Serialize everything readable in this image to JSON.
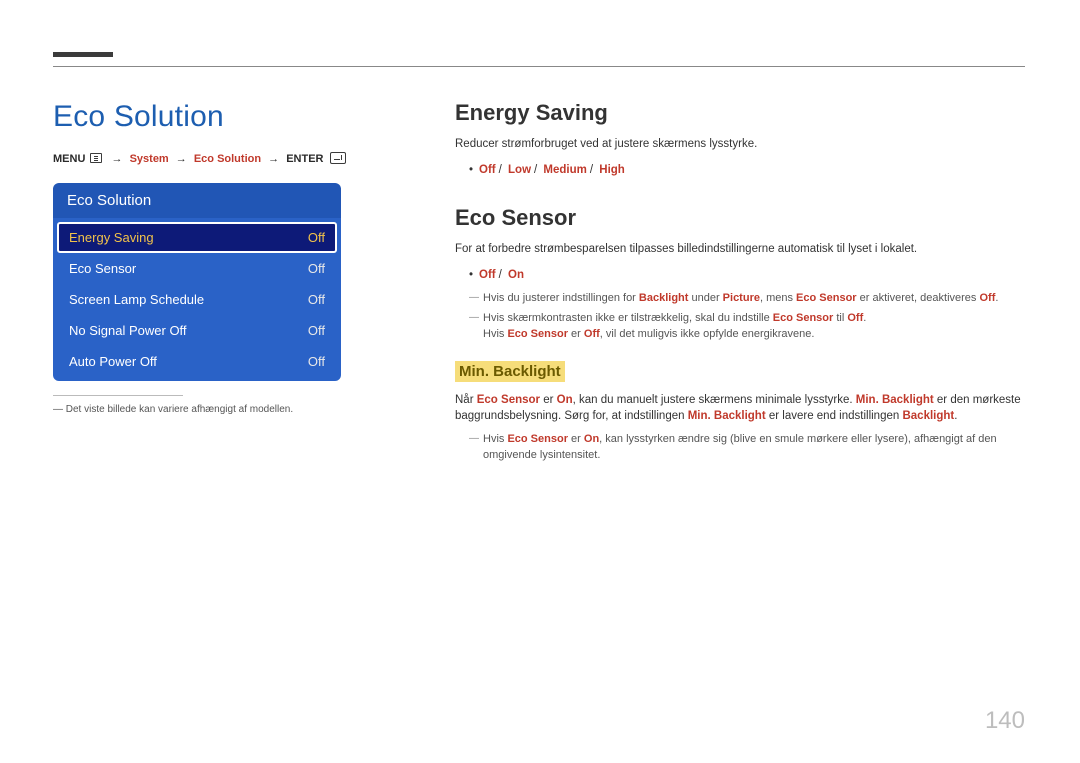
{
  "page_number": "140",
  "main_title": "Eco Solution",
  "breadcrumb": {
    "menu": "MENU",
    "system": "System",
    "eco": "Eco Solution",
    "enter": "ENTER"
  },
  "osd": {
    "title": "Eco Solution",
    "rows": [
      {
        "label": "Energy Saving",
        "value": "Off",
        "selected": true
      },
      {
        "label": "Eco Sensor",
        "value": "Off",
        "selected": false
      },
      {
        "label": "Screen Lamp Schedule",
        "value": "Off",
        "selected": false
      },
      {
        "label": "No Signal Power Off",
        "value": "Off",
        "selected": false
      },
      {
        "label": "Auto Power Off",
        "value": "Off",
        "selected": false
      }
    ]
  },
  "footnote": "― Det viste billede kan variere afhængigt af modellen.",
  "energy_saving": {
    "title": "Energy Saving",
    "desc": "Reducer strømforbruget ved at justere skærmens lysstyrke.",
    "opts": {
      "off": "Off",
      "low": "Low",
      "medium": "Medium",
      "high": "High"
    }
  },
  "eco_sensor": {
    "title": "Eco Sensor",
    "desc": "For at forbedre strømbesparelsen tilpasses billedindstillingerne automatisk til lyset i lokalet.",
    "opts": {
      "off": "Off",
      "on": "On"
    },
    "note1": {
      "pre": "Hvis du justerer indstillingen for ",
      "backlight": "Backlight",
      "mid1": " under ",
      "picture": "Picture",
      "mid2": ", mens ",
      "ecosensor": "Eco Sensor",
      "mid3": " er aktiveret, deaktiveres ",
      "off": "Off",
      "end": "."
    },
    "note2": {
      "pre": "Hvis skærmkontrasten ikke er tilstrækkelig, skal du indstille ",
      "ecosensor": "Eco Sensor",
      "mid": " til ",
      "off": "Off",
      "end": "."
    },
    "note3": {
      "pre": "Hvis ",
      "ecosensor": "Eco Sensor",
      "mid": " er ",
      "off": "Off",
      "end": ", vil det muligvis ikke opfylde energikravene."
    }
  },
  "min_backlight": {
    "title": "Min. Backlight",
    "p1": {
      "pre": "Når ",
      "ecosensor": "Eco Sensor",
      "mid1": " er ",
      "on": "On",
      "mid2": ", kan du manuelt justere skærmens minimale lysstyrke. ",
      "minbl": "Min. Backlight",
      "mid3": " er den mørkeste baggrundsbelysning. Sørg for, at indstillingen ",
      "minbl2": "Min. Backlight",
      "mid4": " er lavere end indstillingen ",
      "backlight": "Backlight",
      "end": "."
    },
    "note": {
      "pre": "Hvis ",
      "ecosensor": "Eco Sensor",
      "mid": " er ",
      "on": "On",
      "end": ", kan lysstyrken ændre sig (blive en smule mørkere eller lysere), afhængigt af den omgivende lysintensitet."
    }
  }
}
